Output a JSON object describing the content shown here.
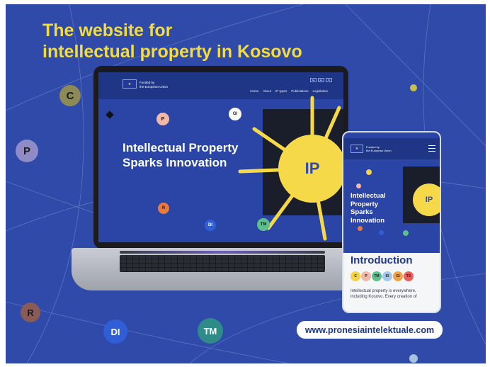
{
  "headline": {
    "line1": "The website for",
    "line2": "intellectual property in Kosovo"
  },
  "bubbles": {
    "c": "C",
    "p": "P",
    "r": "R",
    "di": "DI",
    "tm": "TM"
  },
  "laptop": {
    "funded_line1": "Funded by",
    "funded_line2": "the European Union",
    "nav": [
      "Home",
      "About",
      "IP types",
      "Publications",
      "Legislation"
    ],
    "langs": [
      "Sq",
      "En",
      "Sr"
    ],
    "hero_line1": "Intellectual Property",
    "hero_line2": "Sparks Innovation",
    "sun_label": "IP",
    "bubbles": {
      "p": "P",
      "gi": "GI",
      "r": "R",
      "di": "DI",
      "tm": "TM"
    }
  },
  "phone": {
    "funded_line1": "Funded by",
    "funded_line2": "the European Union",
    "hero_lines": [
      "Intellectual",
      "Property",
      "Sparks",
      "Innovation"
    ],
    "sun_label": "IP",
    "intro_title": "Introduction",
    "chips": [
      "C",
      "P",
      "TM",
      "ID",
      "GI",
      "TS"
    ],
    "body_line1": "Intellectual property is everywhere,",
    "body_line2": "including Kosovo. Every creation of"
  },
  "url": "www.pronesiaintelektuale.com",
  "colors": {
    "background": "#2f4aa8",
    "headline": "#f3dc3c",
    "sun": "#f6d948",
    "chip_c": "#f3d34a",
    "chip_p": "#f2b9a8",
    "chip_tm": "#5fbf8c",
    "chip_id": "#a6c7e8",
    "chip_gi": "#f0a24a",
    "chip_ts": "#e85f5f"
  }
}
